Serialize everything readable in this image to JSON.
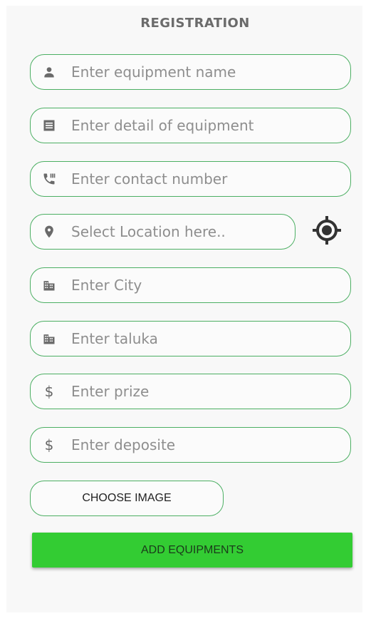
{
  "header": {
    "title": "REGISTRATION"
  },
  "fields": {
    "name": {
      "placeholder": "Enter equipment name",
      "icon": "person-icon"
    },
    "detail": {
      "placeholder": "Enter detail of equipment",
      "icon": "receipt-icon"
    },
    "contact": {
      "placeholder": "Enter contact number",
      "icon": "phone-icon"
    },
    "location": {
      "placeholder": "Select Location here..",
      "icon": "location-pin-icon"
    },
    "city": {
      "placeholder": "Enter City",
      "icon": "building-icon"
    },
    "taluka": {
      "placeholder": "Enter taluka",
      "icon": "building-icon"
    },
    "prize": {
      "placeholder": "Enter prize",
      "icon": "dollar-icon",
      "symbol": "$"
    },
    "deposite": {
      "placeholder": "Enter deposite",
      "icon": "dollar-icon",
      "symbol": "$"
    }
  },
  "buttons": {
    "choose_image": "CHOOSE IMAGE",
    "add_equipments": "ADD EQUIPMENTS"
  },
  "colors": {
    "border": "#4caf63",
    "primary_button": "#33cc33",
    "background": "#f8f8f8"
  }
}
